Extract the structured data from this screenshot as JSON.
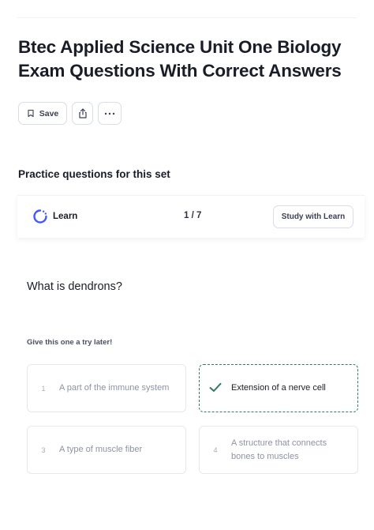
{
  "title": "Btec Applied Science Unit One Biology Exam Questions With Correct Answers",
  "actions": {
    "save_label": "Save",
    "save_icon": "bookmark-icon",
    "share_icon": "share-icon",
    "more_icon": "more-icon"
  },
  "practice": {
    "section_title": "Practice questions for this set",
    "learn_label": "Learn",
    "learn_icon": "learn-progress-icon",
    "progress": "1 / 7",
    "study_button": "Study with Learn"
  },
  "question": {
    "prompt": "What is dendrons?",
    "hint": "Give this one a try later!",
    "options": [
      {
        "number": "1",
        "text": "A part of the immune system",
        "state": "default"
      },
      {
        "number": "",
        "text": "Extension of a nerve cell",
        "state": "correct"
      },
      {
        "number": "3",
        "text": "A type of muscle fiber",
        "state": "default"
      },
      {
        "number": "4",
        "text": "A structure that connects bones to muscles",
        "state": "default"
      }
    ]
  },
  "colors": {
    "accent_blue": "#4257ff",
    "correct_green": "#2e7d5b",
    "border": "#d9dde8"
  }
}
